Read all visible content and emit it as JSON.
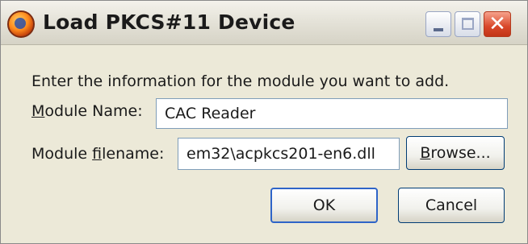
{
  "window": {
    "title": "Load PKCS#11 Device",
    "icon": "firefox-icon",
    "controls": {
      "minimize": "minimize-icon",
      "maximize": "maximize-icon",
      "close": "close-icon"
    }
  },
  "form": {
    "instructions": "Enter the information for the module you want to add.",
    "module_name": {
      "label_prefix": "",
      "label_accel": "M",
      "label_rest": "odule Name:",
      "value": "CAC Reader"
    },
    "module_filename": {
      "label_prefix": "Module ",
      "label_accel": "f",
      "label_rest": "ilename:",
      "value": "em32\\acpkcs201-en6.dll"
    }
  },
  "buttons": {
    "browse": {
      "prefix": "",
      "accel": "B",
      "rest": "rowse..."
    },
    "ok": "OK",
    "cancel": "Cancel"
  }
}
